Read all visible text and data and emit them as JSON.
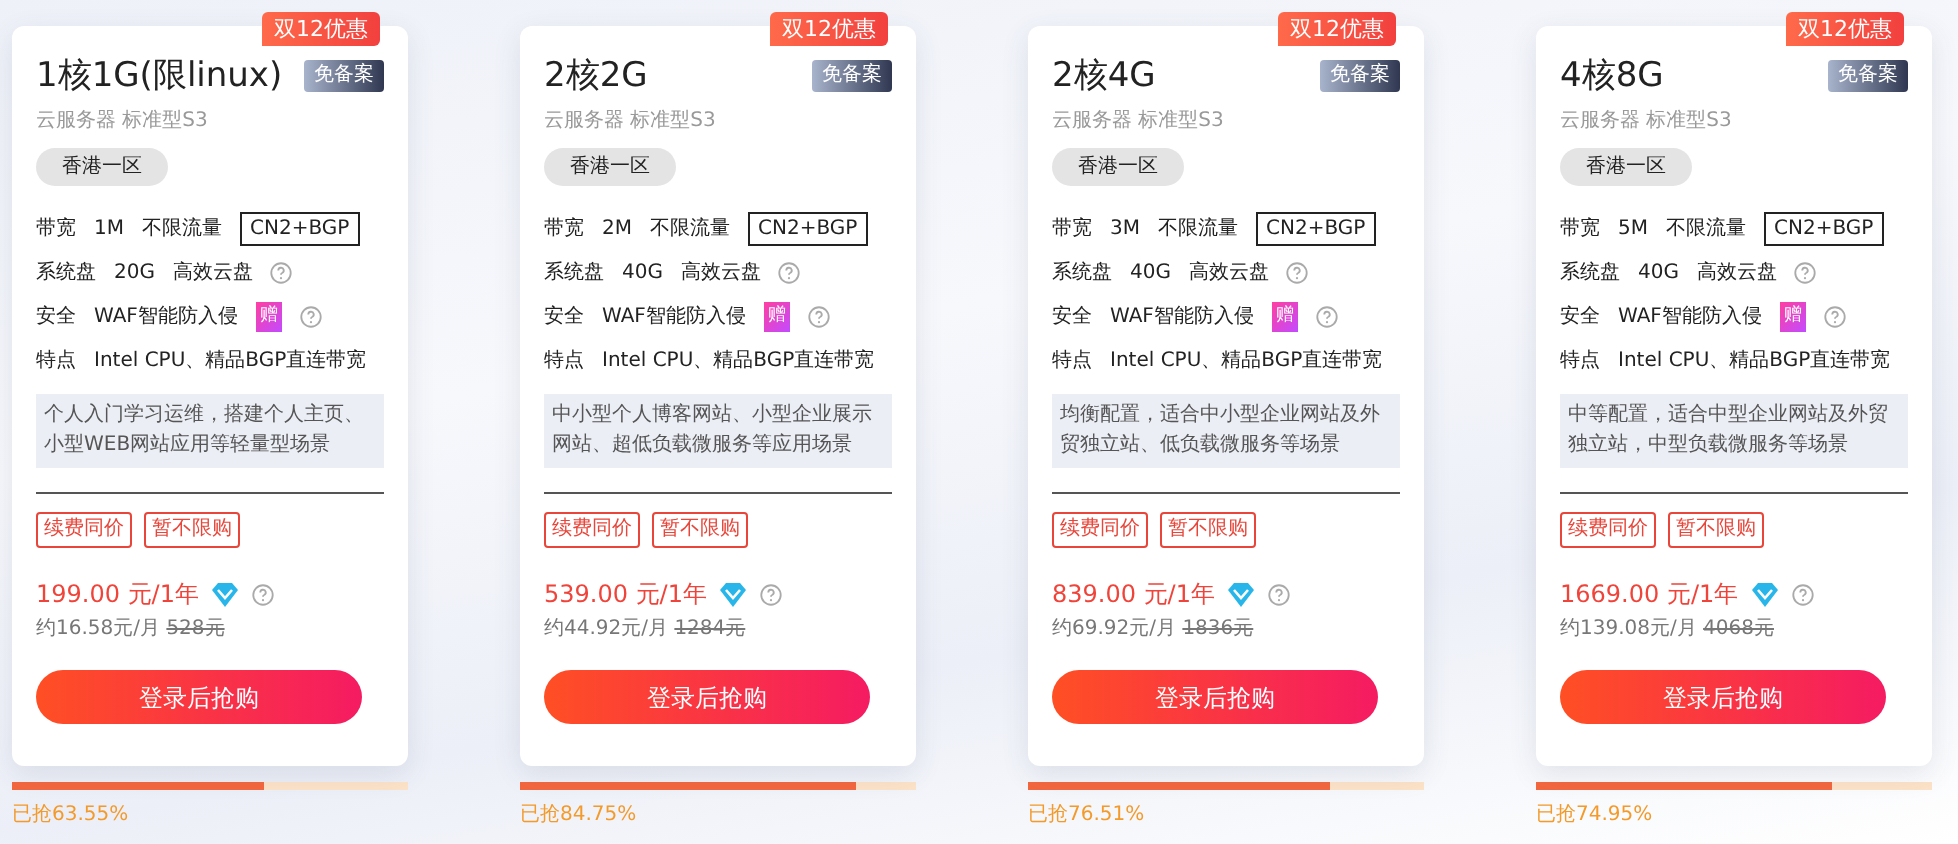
{
  "plans": [
    {
      "ribbon": "双12优惠",
      "title": "1核1G(限linux)",
      "tag": "免备案",
      "subtitle": "云服务器 标准型S3",
      "region": "香港一区",
      "specs": [
        {
          "label": "带宽",
          "value": "1M",
          "note": "不限流量",
          "boxed": "CN2+BGP"
        },
        {
          "label": "系统盘",
          "value": "20G",
          "note": "高效云盘",
          "help": true
        },
        {
          "label": "安全",
          "value": "WAF智能防入侵",
          "gift": "赠",
          "help": true
        },
        {
          "label": "特点",
          "value": "Intel CPU、精品BGP直连带宽"
        }
      ],
      "description": "个人入门学习运维，搭建个人主页、小型WEB网站应用等轻量型场景",
      "promos": [
        "续费同价",
        "暂不限购"
      ],
      "price": "199.00 元/1年",
      "monthly": "约16.58元/月",
      "original_price": "528元",
      "button": "登录后抢购",
      "level": 0.6355,
      "sold": "已抢63.55%"
    },
    {
      "ribbon": "双12优惠",
      "title": "2核2G",
      "tag": "免备案",
      "subtitle": "云服务器 标准型S3",
      "region": "香港一区",
      "specs": [
        {
          "label": "带宽",
          "value": "2M",
          "note": "不限流量",
          "boxed": "CN2+BGP"
        },
        {
          "label": "系统盘",
          "value": "40G",
          "note": "高效云盘",
          "help": true
        },
        {
          "label": "安全",
          "value": "WAF智能防入侵",
          "gift": "赠",
          "help": true
        },
        {
          "label": "特点",
          "value": "Intel CPU、精品BGP直连带宽"
        }
      ],
      "description": "中小型个人博客网站、小型企业展示网站、超低负载微服务等应用场景",
      "promos": [
        "续费同价",
        "暂不限购"
      ],
      "price": "539.00 元/1年",
      "monthly": "约44.92元/月",
      "original_price": "1284元",
      "button": "登录后抢购",
      "level": 0.8475,
      "sold": "已抢84.75%"
    },
    {
      "ribbon": "双12优惠",
      "title": "2核4G",
      "tag": "免备案",
      "subtitle": "云服务器 标准型S3",
      "region": "香港一区",
      "specs": [
        {
          "label": "带宽",
          "value": "3M",
          "note": "不限流量",
          "boxed": "CN2+BGP"
        },
        {
          "label": "系统盘",
          "value": "40G",
          "note": "高效云盘",
          "help": true
        },
        {
          "label": "安全",
          "value": "WAF智能防入侵",
          "gift": "赠",
          "help": true
        },
        {
          "label": "特点",
          "value": "Intel CPU、精品BGP直连带宽"
        }
      ],
      "description": "均衡配置，适合中小型企业网站及外贸独立站、低负载微服务等场景",
      "promos": [
        "续费同价",
        "暂不限购"
      ],
      "price": "839.00 元/1年",
      "monthly": "约69.92元/月",
      "original_price": "1836元",
      "button": "登录后抢购",
      "level": 0.7651,
      "sold": "已抢76.51%"
    },
    {
      "ribbon": "双12优惠",
      "title": "4核8G",
      "tag": "免备案",
      "subtitle": "云服务器 标准型S3",
      "region": "香港一区",
      "specs": [
        {
          "label": "带宽",
          "value": "5M",
          "note": "不限流量",
          "boxed": "CN2+BGP"
        },
        {
          "label": "系统盘",
          "value": "40G",
          "note": "高效云盘",
          "help": true
        },
        {
          "label": "安全",
          "value": "WAF智能防入侵",
          "gift": "赠",
          "help": true
        },
        {
          "label": "特点",
          "value": "Intel CPU、精品BGP直连带宽"
        }
      ],
      "description": "中等配置，适合中型企业网站及外贸独立站，中型负载微服务等场景",
      "promos": [
        "续费同价",
        "暂不限购"
      ],
      "price": "1669.00 元/1年",
      "monthly": "约139.08元/月",
      "original_price": "4068元",
      "button": "登录后抢购",
      "level": 0.7495,
      "sold": "已抢74.95%"
    }
  ]
}
